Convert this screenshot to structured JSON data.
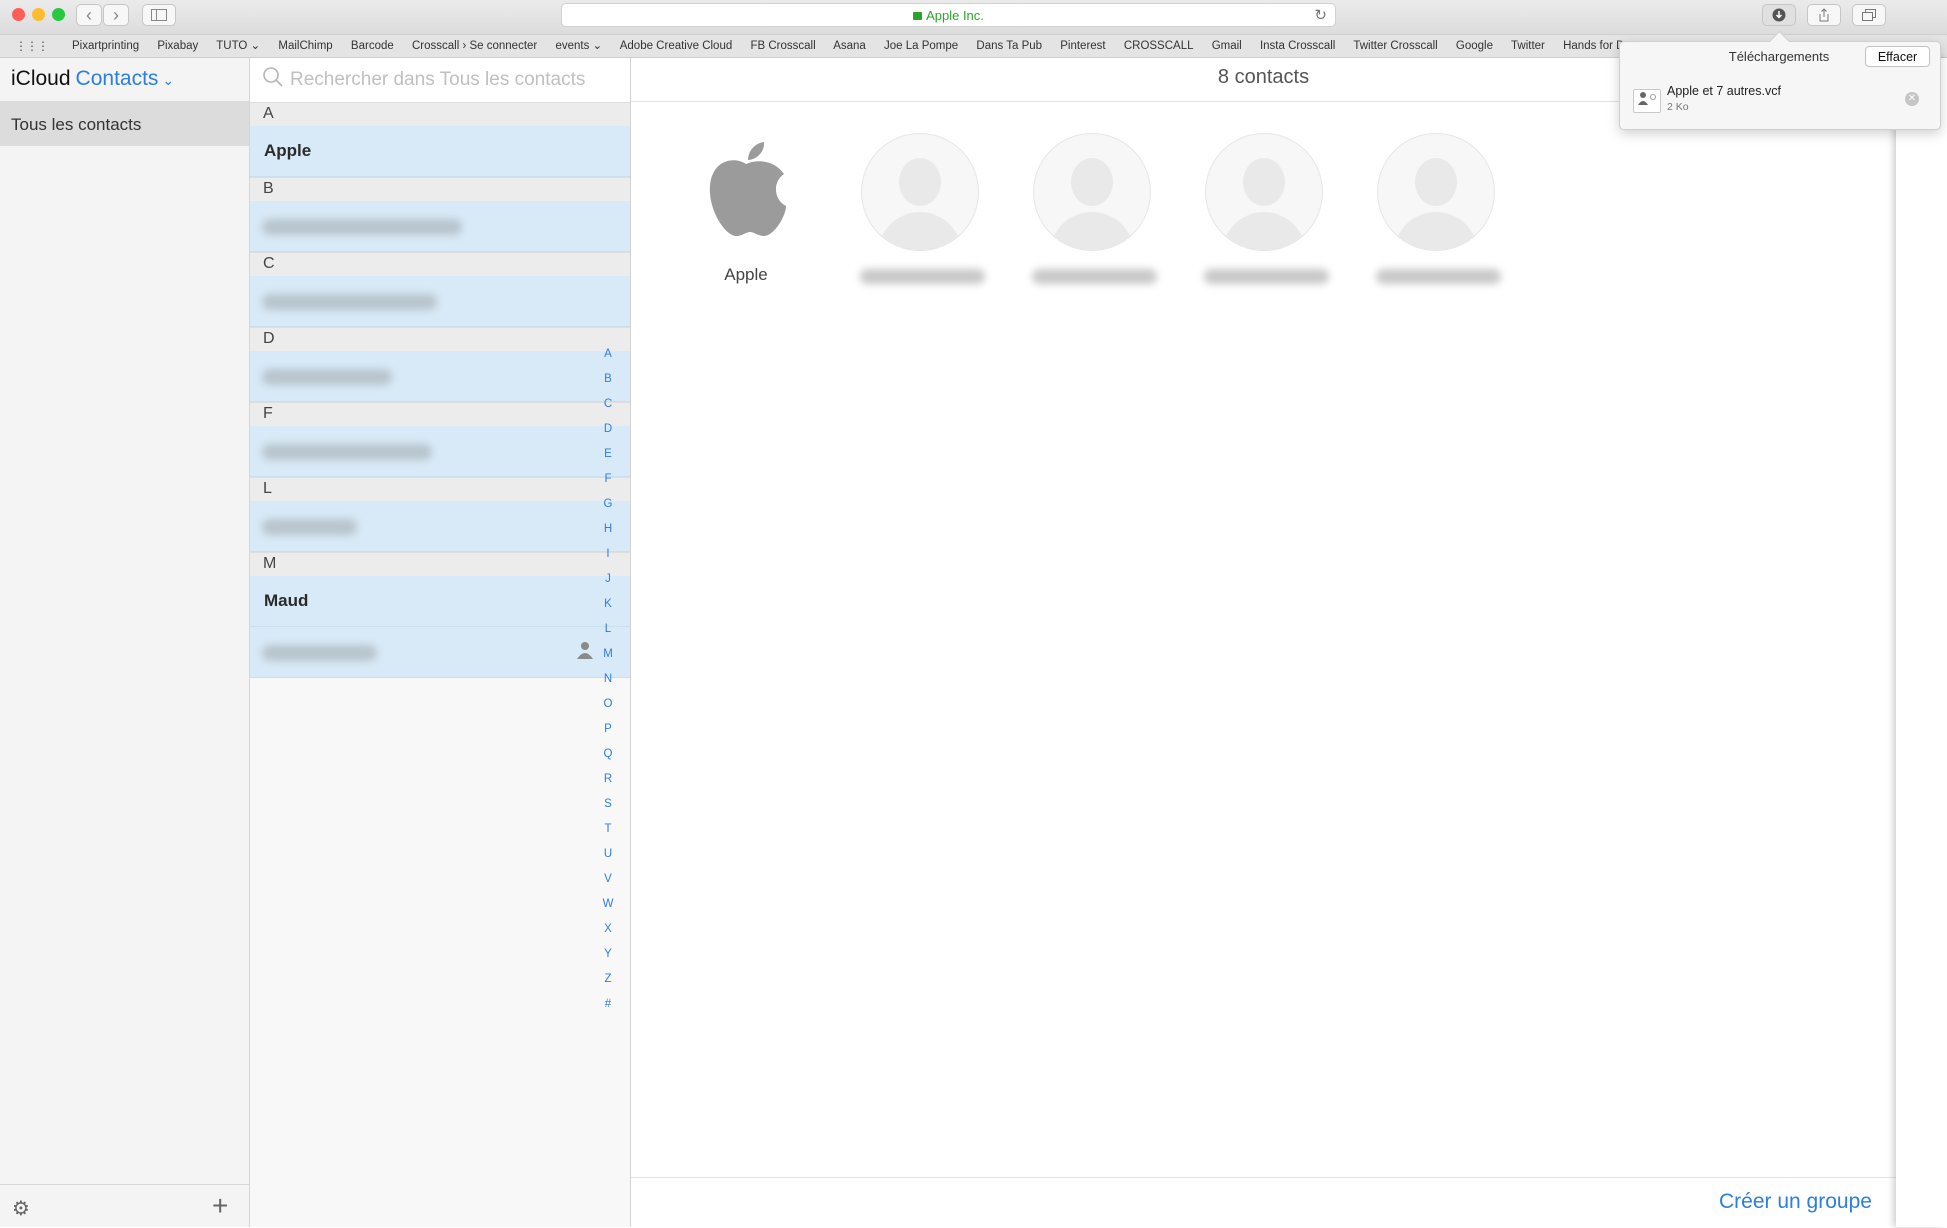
{
  "browser": {
    "address": "Apple Inc.",
    "bookmarks": [
      "Pixartprinting",
      "Pixabay",
      "TUTO ⌄",
      "MailChimp",
      "Barcode",
      "Crosscall › Se connecter",
      "events ⌄",
      "Adobe Creative Cloud",
      "FB Crosscall",
      "Asana",
      "Joe La Pompe",
      "Dans Ta Pub",
      "Pinterest",
      "CROSSCALL",
      "Gmail",
      "Insta Crosscall",
      "Twitter Crosscall",
      "Google",
      "Twitter",
      "Hands for Dr...em"
    ],
    "traffic_colors": {
      "close": "#fc5f57",
      "minimize": "#fdbc2e",
      "zoom": "#28c840"
    }
  },
  "app": {
    "brand": "iCloud",
    "section": "Contacts",
    "group": "Tous les contacts",
    "search_placeholder": "Rechercher dans Tous les contacts",
    "count": "8 contacts",
    "create_group": "Créer un groupe",
    "accent": "#2d7ee0"
  },
  "list": {
    "sections": [
      "A",
      "B",
      "C",
      "D",
      "F",
      "L",
      "M"
    ],
    "named": {
      "apple": "Apple",
      "maud": "Maud"
    }
  },
  "alphabet": [
    "A",
    "B",
    "C",
    "D",
    "E",
    "F",
    "G",
    "H",
    "I",
    "J",
    "K",
    "L",
    "M",
    "N",
    "O",
    "P",
    "Q",
    "R",
    "S",
    "T",
    "U",
    "V",
    "W",
    "X",
    "Y",
    "Z",
    "#"
  ],
  "cards": {
    "apple": "Apple"
  },
  "downloads": {
    "title": "Téléchargements",
    "clear": "Effacer",
    "file_name": "Apple et 7 autres.vcf",
    "file_size": "2 Ko"
  }
}
